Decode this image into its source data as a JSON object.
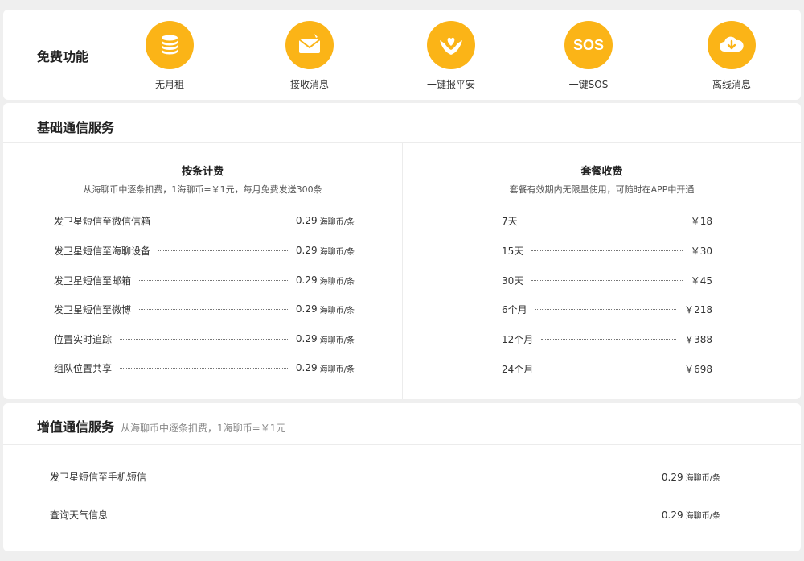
{
  "free": {
    "title": "免费功能",
    "items": [
      {
        "label": "无月租",
        "icon": "coin-stack-icon"
      },
      {
        "label": "接收消息",
        "icon": "envelope-icon"
      },
      {
        "label": "一键报平安",
        "icon": "hands-heart-icon"
      },
      {
        "label": "一键SOS",
        "icon": "sos-icon",
        "icon_text": "SOS"
      },
      {
        "label": "离线消息",
        "icon": "cloud-download-icon"
      }
    ]
  },
  "basic": {
    "title": "基础通信服务",
    "per_item": {
      "title": "按条计费",
      "subtitle": "从海聊币中逐条扣费，1海聊币=￥1元，每月免费发送300条",
      "rows": [
        {
          "name": "发卫星短信至微信信箱",
          "price": "0.29",
          "unit": "海聊币/条"
        },
        {
          "name": "发卫星短信至海聊设备",
          "price": "0.29",
          "unit": "海聊币/条"
        },
        {
          "name": "发卫星短信至邮箱",
          "price": "0.29",
          "unit": "海聊币/条"
        },
        {
          "name": "发卫星短信至微博",
          "price": "0.29",
          "unit": "海聊币/条"
        },
        {
          "name": "位置实时追踪",
          "price": "0.29",
          "unit": "海聊币/条"
        },
        {
          "name": "组队位置共享",
          "price": "0.29",
          "unit": "海聊币/条"
        }
      ]
    },
    "package": {
      "title": "套餐收费",
      "subtitle": "套餐有效期内无限量使用，可随时在APP中开通",
      "rows": [
        {
          "name": "7天",
          "price": "￥18"
        },
        {
          "name": "15天",
          "price": "￥30"
        },
        {
          "name": "30天",
          "price": "￥45"
        },
        {
          "name": "6个月",
          "price": "￥218"
        },
        {
          "name": "12个月",
          "price": "￥388"
        },
        {
          "name": "24个月",
          "price": "￥698"
        }
      ]
    }
  },
  "value_added": {
    "title": "增值通信服务",
    "subtitle": "从海聊币中逐条扣费，1海聊币=￥1元",
    "rows": [
      {
        "name": "发卫星短信至手机短信",
        "price": "0.29",
        "unit": "海聊币/条"
      },
      {
        "name": "查询天气信息",
        "price": "0.29",
        "unit": "海聊币/条"
      }
    ]
  },
  "colors": {
    "accent": "#fbb417",
    "background": "#efefef",
    "card": "#ffffff"
  }
}
